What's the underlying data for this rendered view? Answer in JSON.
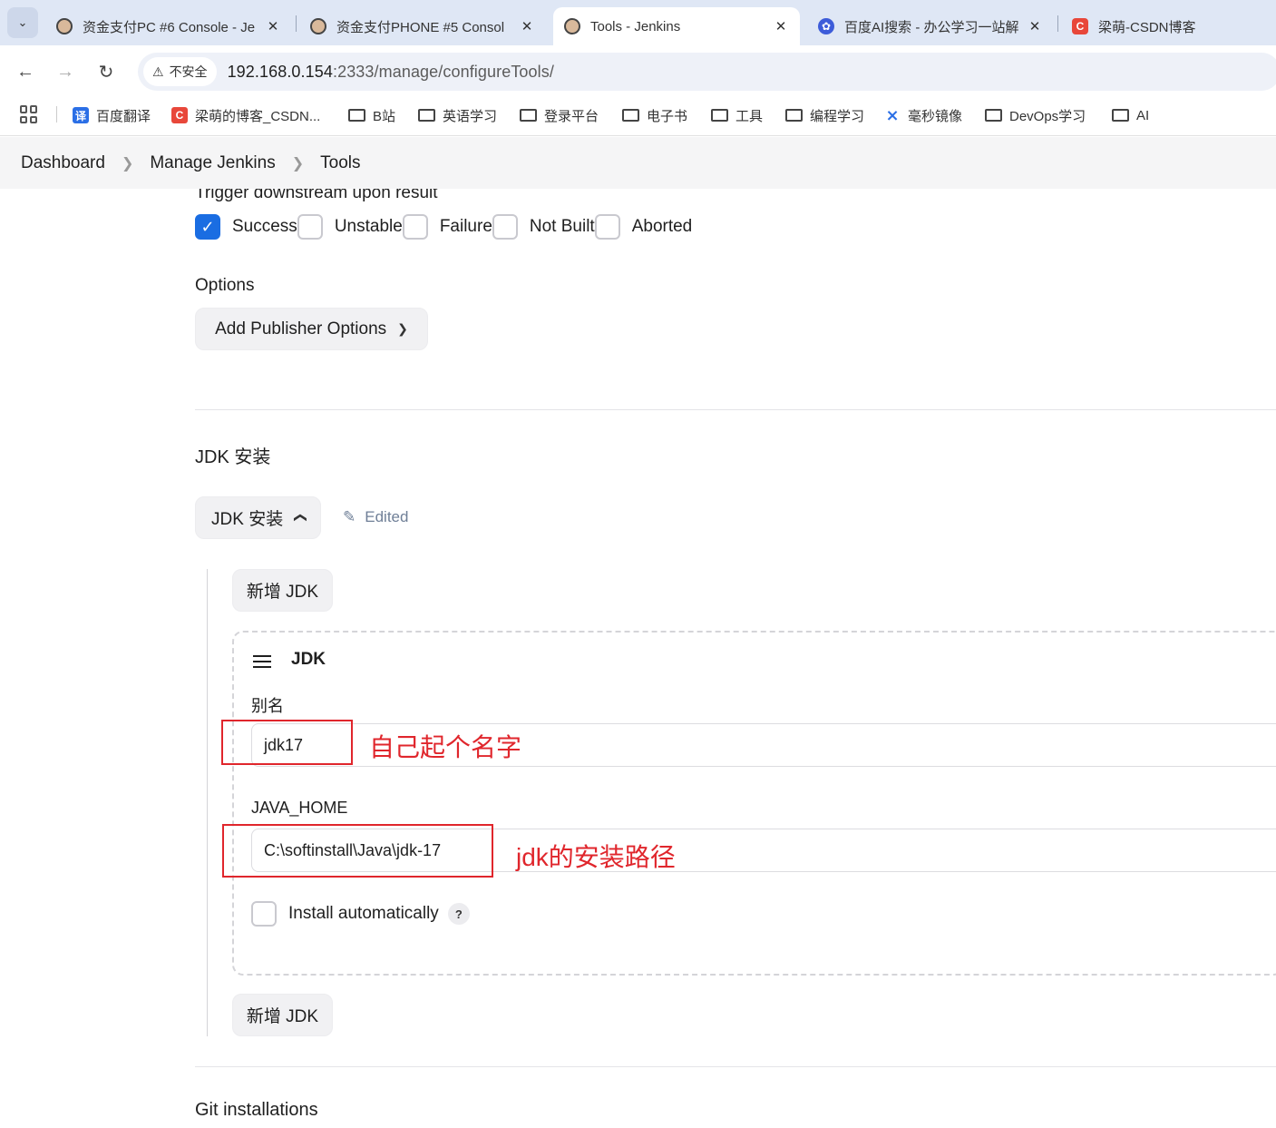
{
  "browser": {
    "tabs": [
      {
        "title": "资金支付PC #6 Console - Je",
        "favicon": "jenkins-icon",
        "active": false
      },
      {
        "title": "资金支付PHONE #5 Consol",
        "favicon": "jenkins-icon",
        "active": false
      },
      {
        "title": "Tools - Jenkins",
        "favicon": "jenkins-icon",
        "active": true
      },
      {
        "title": "百度AI搜索 - 办公学习一站解",
        "favicon": "baidu-icon",
        "active": false
      },
      {
        "title": "梁萌-CSDN博客",
        "favicon": "csdn-icon",
        "active": false
      }
    ],
    "security_label": "不安全",
    "url_host": "192.168.0.154",
    "url_rest": ":2333/manage/configureTools/",
    "bookmarks": [
      {
        "label": "百度翻译",
        "icon": "fanyi-icon",
        "glyph": "译"
      },
      {
        "label": "梁萌的博客_CSDN...",
        "icon": "csdn-icon",
        "glyph": "C"
      },
      {
        "label": "B站",
        "icon": "folder-icon"
      },
      {
        "label": "英语学习",
        "icon": "folder-icon"
      },
      {
        "label": "登录平台",
        "icon": "folder-icon"
      },
      {
        "label": "电子书",
        "icon": "folder-icon"
      },
      {
        "label": "工具",
        "icon": "folder-icon"
      },
      {
        "label": "编程学习",
        "icon": "folder-icon"
      },
      {
        "label": "毫秒镜像",
        "icon": "mirror-icon"
      },
      {
        "label": "DevOps学习",
        "icon": "folder-icon"
      },
      {
        "label": "AI",
        "icon": "folder-icon"
      }
    ]
  },
  "breadcrumb": [
    "Dashboard",
    "Manage Jenkins",
    "Tools"
  ],
  "trigger": {
    "label": "Trigger downstream upon result",
    "options": [
      {
        "label": "Success",
        "checked": true
      },
      {
        "label": "Unstable",
        "checked": false
      },
      {
        "label": "Failure",
        "checked": false
      },
      {
        "label": "Not Built",
        "checked": false
      },
      {
        "label": "Aborted",
        "checked": false
      }
    ]
  },
  "options": {
    "label": "Options",
    "add_button": "Add Publisher Options"
  },
  "jdk": {
    "section_title": "JDK 安装",
    "toggle_button": "JDK 安装",
    "edited_label": "Edited",
    "add_button_top": "新增 JDK",
    "add_button_bottom": "新增 JDK",
    "item_title": "JDK",
    "alias_label": "别名",
    "alias_value": "jdk17",
    "home_label": "JAVA_HOME",
    "home_value": "C:\\softinstall\\Java\\jdk-17",
    "install_auto_label": "Install automatically",
    "install_auto_checked": false,
    "help_glyph": "?"
  },
  "annotations": {
    "alias_note": "自己起个名字",
    "home_note": "jdk的安装路径",
    "color": "#e0262c"
  },
  "git": {
    "section_title": "Git installations"
  },
  "colors": {
    "accent": "#1a6de2",
    "tab_bar": "#dfe7f5",
    "breadcrumb_bg": "#f5f5f6"
  }
}
